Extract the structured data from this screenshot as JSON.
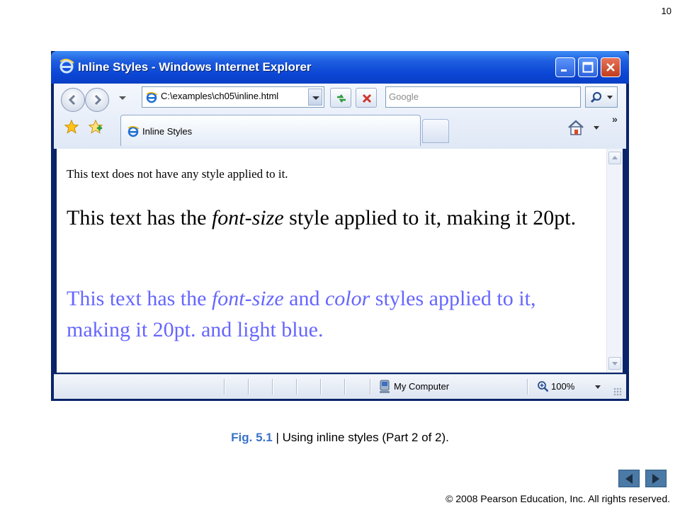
{
  "slide": {
    "number": "10"
  },
  "window": {
    "title": "Inline Styles - Windows Internet Explorer",
    "address": "C:\\examples\\ch05\\inline.html",
    "search_placeholder": "Google",
    "tab_label": "Inline Styles"
  },
  "content": {
    "plain_line": "This text does not have any style applied to it.",
    "para1_before": "This text has the ",
    "para1_em": "font-size",
    "para1_after": " style applied to it, making it 20pt.",
    "para2_before": "This text has the ",
    "para2_em1": "font-size",
    "para2_mid": " and ",
    "para2_em2": "color",
    "para2_after": " styles applied to it, making it 20pt. and light blue.",
    "para2_color": "#6666ff"
  },
  "status": {
    "zone": "My Computer",
    "zoom": "100%"
  },
  "caption": {
    "fig": "Fig. 5.1",
    "separator": " | ",
    "text": "Using inline styles (Part 2 of 2)."
  },
  "footer": {
    "copyright": "© 2008 Pearson Education, Inc.  All rights reserved."
  }
}
